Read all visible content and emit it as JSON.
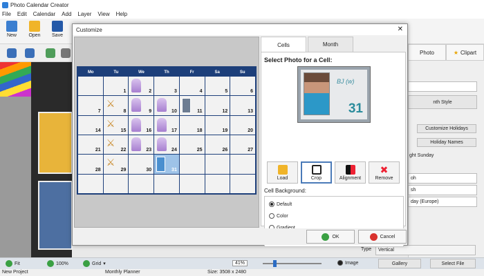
{
  "app": {
    "title": "Photo Calendar Creator",
    "menu": [
      "File",
      "Edit",
      "Calendar",
      "Add",
      "Layer",
      "View",
      "Help"
    ],
    "toolbar": [
      "New",
      "Open",
      "Save"
    ]
  },
  "right_panel": {
    "tabs": [
      "Photo",
      "Clipart"
    ],
    "month_style": "nth Style",
    "customize_holidays": "Customize Holidays",
    "holiday_names": "Holiday Names",
    "ght_sunday": "ght Sunday",
    "select_a": "oh",
    "select_b": "sh",
    "select_c": "day (Europe)",
    "type_label": "Type",
    "type_value": "Vertical",
    "image_label": "Image",
    "gallery": "Gallery",
    "select_file": "Select File"
  },
  "zoom": {
    "fit": "Fit",
    "percent": "100%",
    "grid": "Grid",
    "zoom_value": "41%"
  },
  "status": {
    "project": "New Project",
    "template": "Monthly Planner",
    "size": "Size: 3508 x 2480"
  },
  "dialog": {
    "title": "Customize",
    "tabs": [
      "Cells",
      "Month"
    ],
    "select_title": "Select Photo for a Cell:",
    "photo_name": "BJ (w)",
    "photo_day": "31",
    "actions": [
      "Load",
      "Crop",
      "Alignment",
      "Remove"
    ],
    "bg_title": "Cell Background:",
    "bg_options": [
      "Default",
      "Color",
      "Gradient"
    ],
    "ok": "OK",
    "cancel": "Cancel"
  },
  "calendar": {
    "weekdays": [
      "Mo",
      "Tu",
      "We",
      "Th",
      "Fr",
      "Sa",
      "Su"
    ],
    "weeks": [
      [
        "",
        "1",
        "2",
        "3",
        "4",
        "5",
        "6"
      ],
      [
        "7",
        "8",
        "9",
        "10",
        "11",
        "12",
        "13"
      ],
      [
        "14",
        "15",
        "16",
        "17",
        "18",
        "19",
        "20"
      ],
      [
        "21",
        "22",
        "23",
        "24",
        "25",
        "26",
        "27"
      ],
      [
        "28",
        "29",
        "30",
        "31",
        "",
        "",
        ""
      ],
      [
        "",
        "",
        "",
        "",
        "",
        "",
        ""
      ]
    ],
    "accent": "#1d3f7a"
  }
}
